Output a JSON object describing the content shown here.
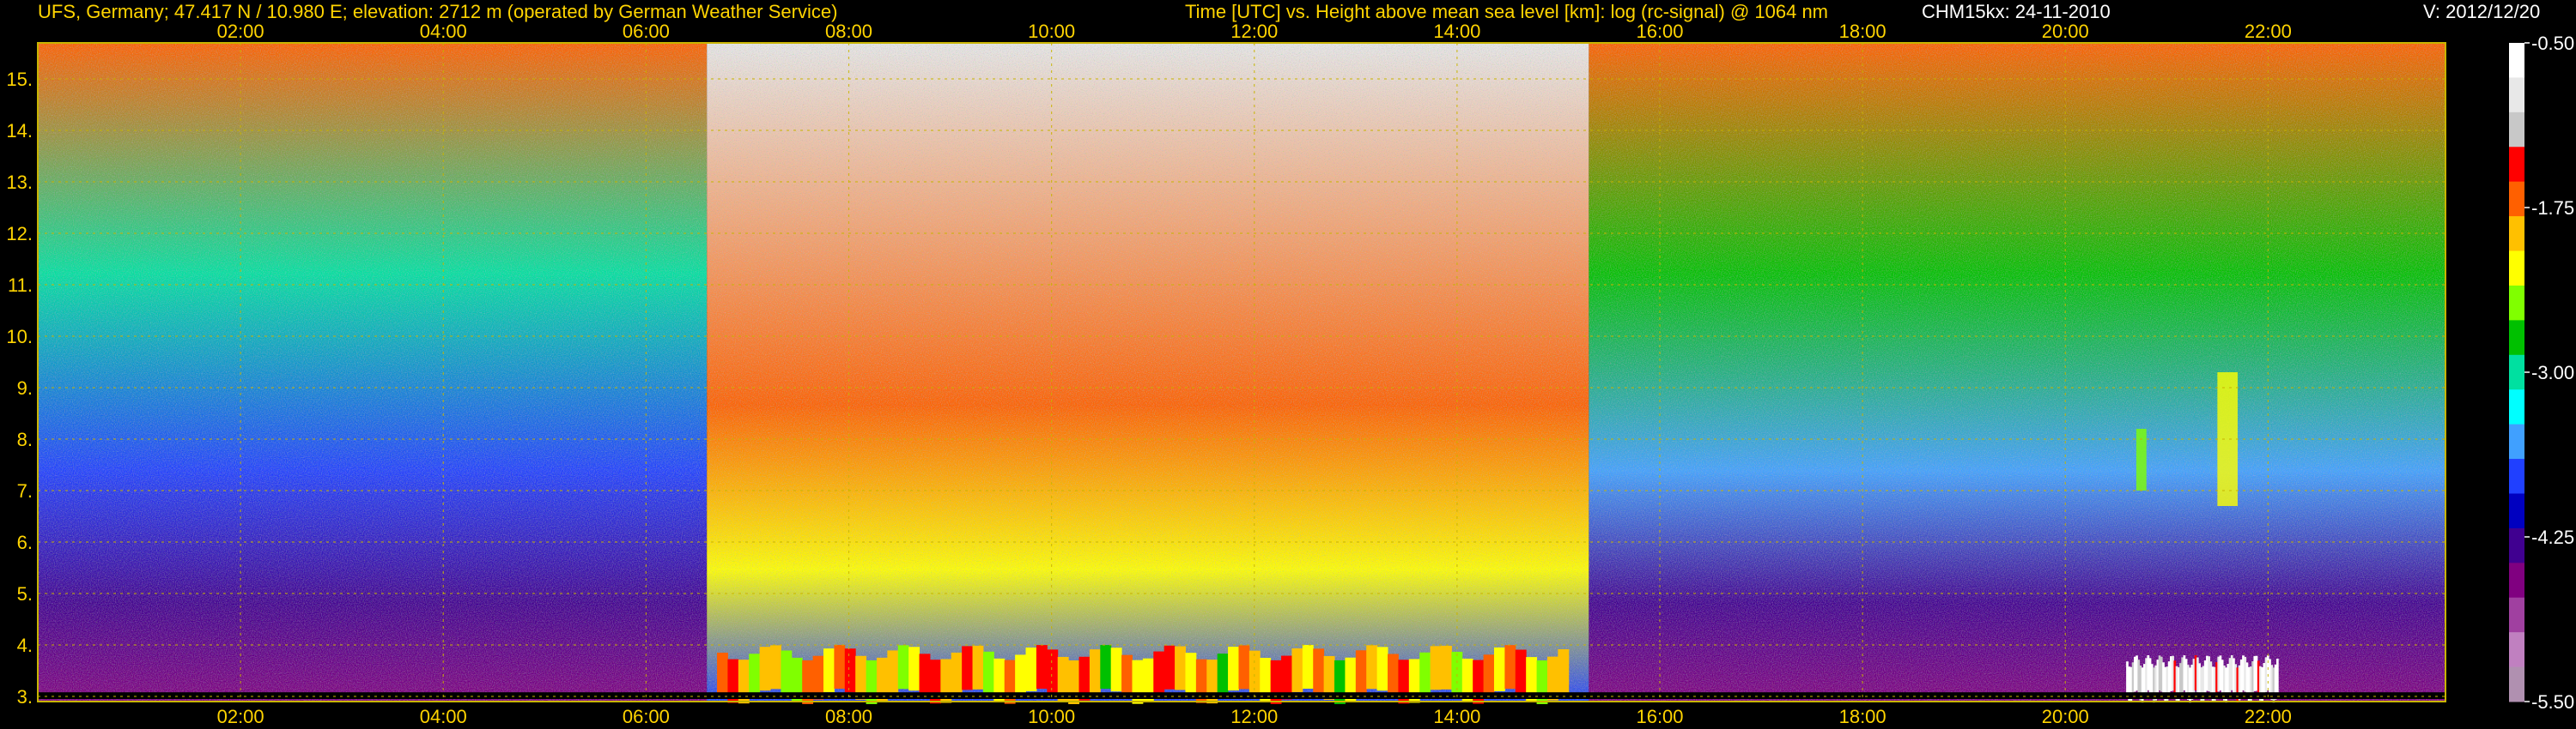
{
  "header": {
    "station": "UFS, Germany; 47.417 N / 10.980 E; elevation: 2712 m  (operated by German Weather Service)",
    "description": "Time [UTC] vs. Height above mean sea level [km]: log (rc-signal) @ 1064 nm",
    "instrument_date": "CHM15kx: 24-11-2010",
    "version": "V: 2012/12/20"
  },
  "colors": {
    "text": "#ffd400",
    "grid": "#c8b400",
    "background": "#000000"
  },
  "chart_data": {
    "type": "heatmap",
    "x_tick_labels": [
      "02:00",
      "04:00",
      "06:00",
      "08:00",
      "10:00",
      "12:00",
      "14:00",
      "16:00",
      "18:00",
      "20:00",
      "22:00"
    ],
    "x_tick_hours": [
      2,
      4,
      6,
      8,
      10,
      12,
      14,
      16,
      18,
      20,
      22
    ],
    "xlim_hours": [
      0.0,
      23.75
    ],
    "y_tick_labels": [
      "3.",
      "4.",
      "5.",
      "6.",
      "7.",
      "8.",
      "9.",
      "10.",
      "11.",
      "12.",
      "13.",
      "14.",
      "15."
    ],
    "y_tick_km": [
      3,
      4,
      5,
      6,
      7,
      8,
      9,
      10,
      11,
      12,
      13,
      14,
      15
    ],
    "ylim_km": [
      2.9,
      15.7
    ],
    "grid": true,
    "colorbar": {
      "position": "right",
      "tick_labels": [
        "-0.50",
        "-1.75",
        "-3.00",
        "-4.25",
        "-5.50"
      ],
      "tick_values": [
        -0.5,
        -1.75,
        -3.0,
        -4.25,
        -5.5
      ],
      "range": [
        -5.5,
        -0.5
      ],
      "colors_top_to_bottom": [
        "#ffffff",
        "#e8e8e8",
        "#c8c8c8",
        "#ff0000",
        "#ff6000",
        "#ffc000",
        "#ffff00",
        "#80ff00",
        "#00c000",
        "#00e0a0",
        "#00ffff",
        "#40a0ff",
        "#2040ff",
        "#0000c0",
        "#400090",
        "#800080",
        "#a040a0",
        "#c080c0",
        "#b090b0"
      ]
    },
    "regions": [
      {
        "t_start": 0.0,
        "t_end": 6.6,
        "h_low": 2.9,
        "h_high": 15.7,
        "background_value": -3.3
      },
      {
        "t_start": 6.6,
        "t_end": 15.3,
        "h_low": 2.9,
        "h_high": 15.7,
        "background_value": -1.3
      },
      {
        "t_start": 15.3,
        "t_end": 23.75,
        "h_low": 2.9,
        "h_high": 15.7,
        "background_value": -3.2
      }
    ],
    "boundary_layer": [
      {
        "t_start": 6.7,
        "t_end": 15.1,
        "h_low": 3.0,
        "h_high": 4.0,
        "value": -1.9
      },
      {
        "t_start": 20.6,
        "t_end": 22.1,
        "h_low": 3.0,
        "h_high": 3.8,
        "value": -0.6
      }
    ],
    "cloud_streaks": [
      {
        "t_start": 20.7,
        "t_end": 20.8,
        "h_low": 7.0,
        "h_high": 8.2,
        "value": -2.4
      },
      {
        "t_start": 21.5,
        "t_end": 21.7,
        "h_low": 6.7,
        "h_high": 9.3,
        "value": -2.2
      }
    ]
  }
}
